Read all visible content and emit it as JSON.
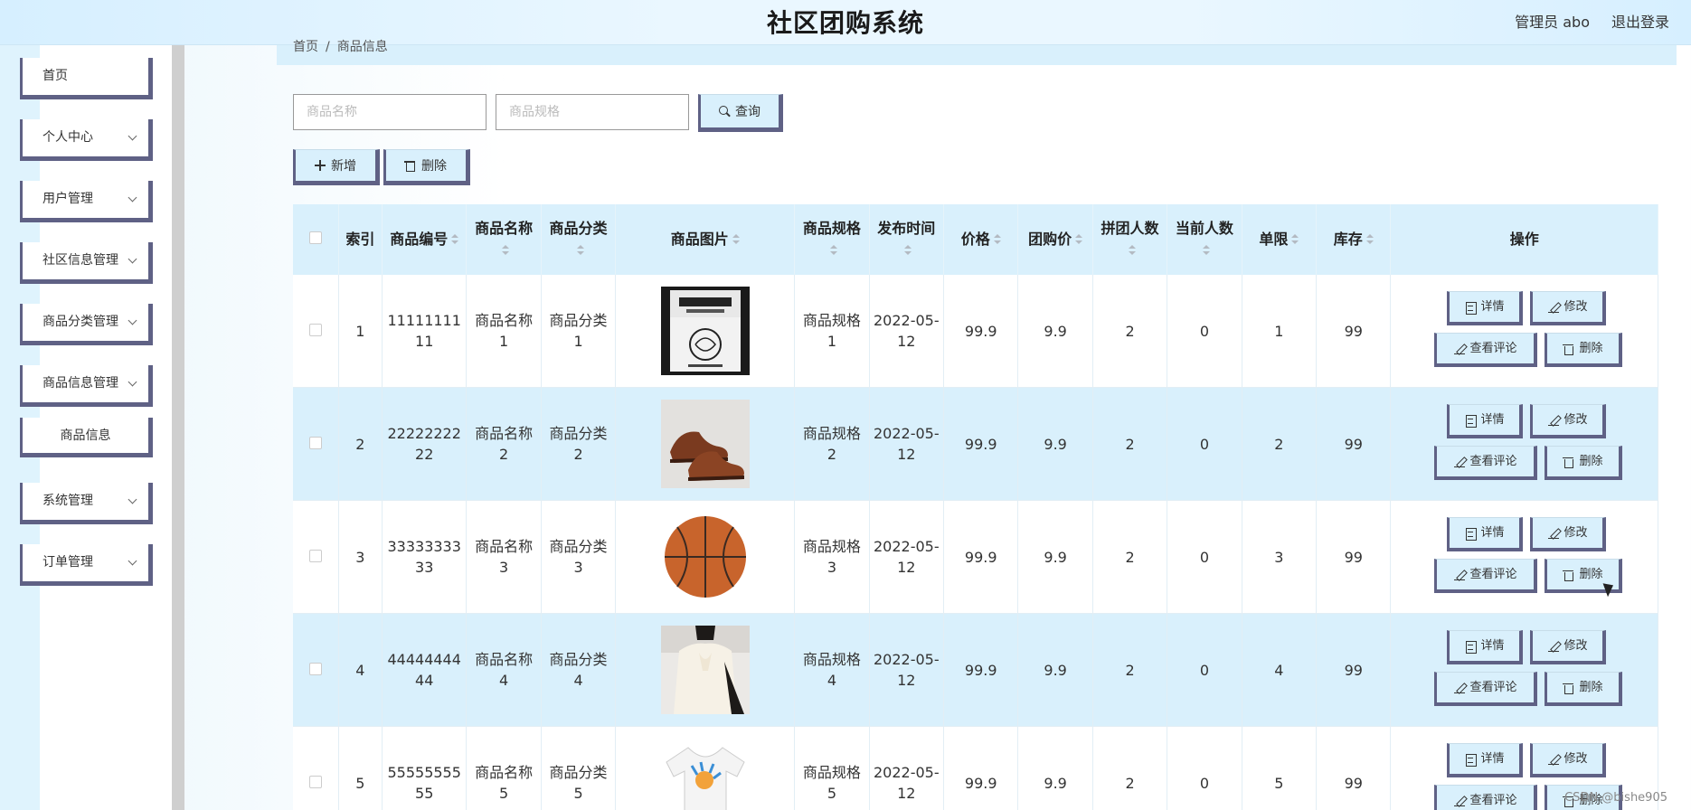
{
  "header": {
    "title": "社区团购系统",
    "user": "管理员 abo",
    "logout": "退出登录"
  },
  "sidebar": {
    "items": [
      {
        "label": "首页",
        "expandable": false
      },
      {
        "label": "个人中心",
        "expandable": true
      },
      {
        "label": "用户管理",
        "expandable": true
      },
      {
        "label": "社区信息管理",
        "expandable": true
      },
      {
        "label": "商品分类管理",
        "expandable": true
      },
      {
        "label": "商品信息管理",
        "expandable": true
      },
      {
        "label": "商品信息",
        "expandable": false,
        "sub": true
      },
      {
        "label": "系统管理",
        "expandable": true
      },
      {
        "label": "订单管理",
        "expandable": true
      }
    ]
  },
  "breadcrumb": {
    "home": "首页",
    "sep": "/",
    "current": "商品信息"
  },
  "search": {
    "name_placeholder": "商品名称",
    "spec_placeholder": "商品规格",
    "query_label": "查询"
  },
  "toolbar": {
    "add_label": "新增",
    "delete_label": "删除"
  },
  "table": {
    "headers": [
      "索引",
      "商品编号",
      "商品名称",
      "商品分类",
      "商品图片",
      "商品规格",
      "发布时间",
      "价格",
      "团购价",
      "拼团人数",
      "当前人数",
      "单限",
      "库存",
      "操作"
    ],
    "rows": [
      {
        "index": "1",
        "code": "1111111111",
        "name": "商品名称1",
        "category": "商品分类1",
        "image": "book",
        "spec": "商品规格1",
        "date": "2022-05-12",
        "price": "99.9",
        "group_price": "9.9",
        "group_size": "2",
        "current": "0",
        "limit": "1",
        "stock": "99"
      },
      {
        "index": "2",
        "code": "2222222222",
        "name": "商品名称2",
        "category": "商品分类2",
        "image": "shoes",
        "spec": "商品规格2",
        "date": "2022-05-12",
        "price": "99.9",
        "group_price": "9.9",
        "group_size": "2",
        "current": "0",
        "limit": "2",
        "stock": "99"
      },
      {
        "index": "3",
        "code": "3333333333",
        "name": "商品名称3",
        "category": "商品分类3",
        "image": "basketball",
        "spec": "商品规格3",
        "date": "2022-05-12",
        "price": "99.9",
        "group_price": "9.9",
        "group_size": "2",
        "current": "0",
        "limit": "3",
        "stock": "99"
      },
      {
        "index": "4",
        "code": "4444444444",
        "name": "商品名称4",
        "category": "商品分类4",
        "image": "blouse",
        "spec": "商品规格4",
        "date": "2022-05-12",
        "price": "99.9",
        "group_price": "9.9",
        "group_size": "2",
        "current": "0",
        "limit": "4",
        "stock": "99"
      },
      {
        "index": "5",
        "code": "5555555555",
        "name": "商品名称5",
        "category": "商品分类5",
        "image": "tshirt",
        "spec": "商品规格5",
        "date": "2022-05-12",
        "price": "99.9",
        "group_price": "9.9",
        "group_size": "2",
        "current": "0",
        "limit": "5",
        "stock": "99"
      }
    ],
    "ops": {
      "detail": "详情",
      "edit": "修改",
      "comments": "查看评论",
      "delete": "删除"
    }
  },
  "watermark": "CSDN @bishe905",
  "colors": {
    "accent": "#5f6185",
    "header_bg": "#d9f0fc",
    "row_alt": "#d9f0fc"
  }
}
